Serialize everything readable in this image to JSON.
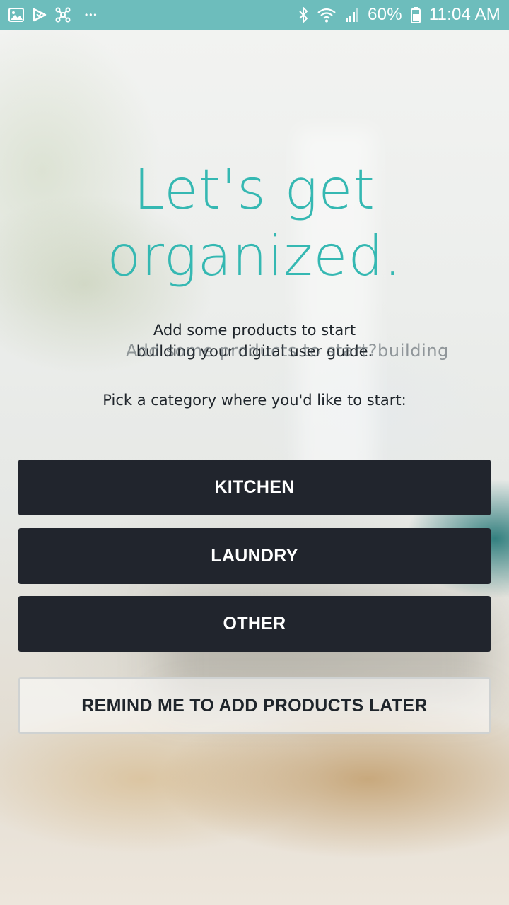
{
  "status_bar": {
    "left_icons": [
      "gallery-icon",
      "play-store-icon",
      "network-icon",
      "more-notifications-icon"
    ],
    "right_icons": [
      "bluetooth-icon",
      "wifi-icon",
      "signal-icon",
      "battery-icon"
    ],
    "more_dots": "•••",
    "battery_percent": "60%",
    "time": "11:04 AM",
    "background_color": "#6dbdbc"
  },
  "onboarding": {
    "headline_line1": "Let's get",
    "headline_line2": "organized.",
    "intro_line1": "Add some products to start",
    "intro_line2": "building your digital user guide.",
    "intro_overlay": "Add some products to start?building",
    "category_prompt": "Pick a category where you'd like to start:",
    "accent_color": "#35b8b2"
  },
  "categories": {
    "kitchen_label": "KITCHEN",
    "laundry_label": "LAUNDRY",
    "other_label": "OTHER",
    "button_color": "#21252d"
  },
  "remind_label": "REMIND ME TO ADD PRODUCTS LATER"
}
